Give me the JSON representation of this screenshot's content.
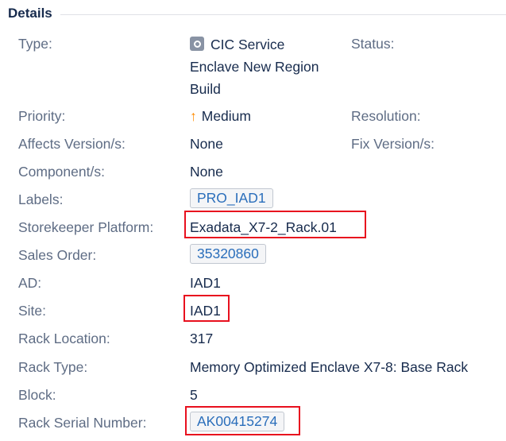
{
  "section": {
    "title": "Details"
  },
  "fields": {
    "type_label": "Type:",
    "type_line1": "CIC Service",
    "type_line2": "Enclave New Region",
    "type_line3": "Build",
    "status_label": "Status:",
    "priority_label": "Priority:",
    "priority_value": "Medium",
    "resolution_label": "Resolution:",
    "affects_label": "Affects Version/s:",
    "affects_value": "None",
    "fix_label": "Fix Version/s:",
    "component_label": "Component/s:",
    "component_value": "None",
    "labels_label": "Labels:",
    "labels_value": "PRO_IAD1",
    "platform_label": "Storekeeper Platform:",
    "platform_value": "Exadata_X7-2_Rack.01",
    "sales_label": "Sales Order:",
    "sales_value": "35320860",
    "ad_label": "AD:",
    "ad_value": "IAD1",
    "site_label": "Site:",
    "site_value": "IAD1",
    "rack_location_label": "Rack Location:",
    "rack_location_value": "317",
    "rack_type_label": "Rack Type:",
    "rack_type_value": "Memory Optimized Enclave X7-8: Base Rack",
    "block_label": "Block:",
    "block_value": "5",
    "serial_label": "Rack Serial Number:",
    "serial_value": "AK00415274"
  },
  "icons": {
    "type_icon": "service-icon",
    "priority_icon": "arrow-up-icon"
  },
  "colors": {
    "priority_medium": "#ff8b00",
    "highlight": "#e8101e",
    "link": "#2a6ebb"
  }
}
